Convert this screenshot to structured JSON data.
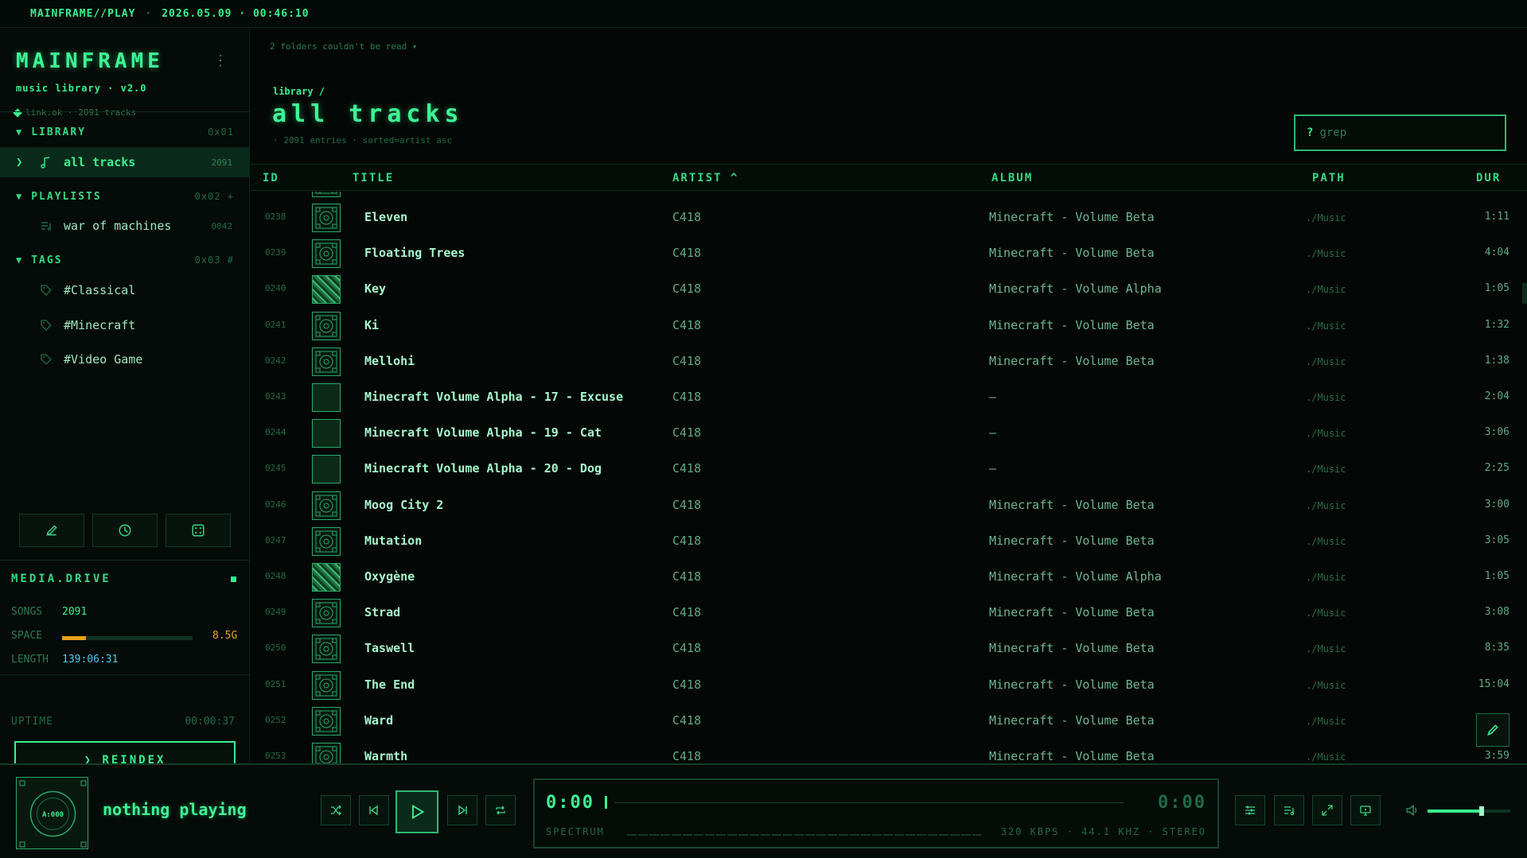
{
  "topbar": {
    "brand": "MAINFRAME//PLAY",
    "separator": "·",
    "datetime": "2026.05.09 · 00:46:10"
  },
  "sidebar": {
    "logo": "MAINFRAME",
    "subtitle": "music library · v2.0",
    "status": "link.ok · 2091 tracks",
    "library": {
      "title": "LIBRARY",
      "hex": "0x01",
      "items": [
        {
          "label": "all tracks",
          "count": "2091",
          "icon": "music-note-icon"
        }
      ]
    },
    "playlists": {
      "title": "PLAYLISTS",
      "hex": "0x02 +",
      "items": [
        {
          "label": "war of machines",
          "count": "0042",
          "icon": "playlist-icon"
        }
      ]
    },
    "tags": {
      "title": "TAGS",
      "hex": "0x03 #",
      "items": [
        {
          "label": "#Classical",
          "icon": "tag-icon"
        },
        {
          "label": "#Minecraft",
          "icon": "tag-icon"
        },
        {
          "label": "#Video Game",
          "icon": "tag-icon"
        }
      ]
    },
    "tools": [
      "pencil-icon",
      "clock-icon",
      "dice-icon"
    ],
    "drive": {
      "title": "MEDIA.DRIVE",
      "songs_label": "SONGS",
      "songs": "2091",
      "space_label": "SPACE",
      "space": "8.5G",
      "space_fraction": 0.18,
      "length_label": "LENGTH",
      "length": "139:06:31",
      "uptime_label": "UPTIME",
      "uptime": "00:00:37",
      "reindex_label": "❯ REINDEX"
    }
  },
  "main": {
    "warning": "2 folders couldn't be read ▾",
    "breadcrumb": "library /",
    "title": "all tracks",
    "entries": "· 2091 entries · sorted=artist asc",
    "search_placeholder": "grep",
    "search_prompt": "?",
    "columns": {
      "id": "ID",
      "title": "TITLE",
      "artist": "ARTIST ^",
      "album": "ALBUM",
      "path": "PATH",
      "dur": "DUR"
    },
    "tracks": [
      {
        "id": "0238",
        "title": "Eleven",
        "artist": "C418",
        "album": "Minecraft - Volume Beta",
        "path": "./Music",
        "dur": "1:11",
        "art": "beta"
      },
      {
        "id": "0239",
        "title": "Floating Trees",
        "artist": "C418",
        "album": "Minecraft - Volume Beta",
        "path": "./Music",
        "dur": "4:04",
        "art": "beta"
      },
      {
        "id": "0240",
        "title": "Key",
        "artist": "C418",
        "album": "Minecraft - Volume Alpha",
        "path": "./Music",
        "dur": "1:05",
        "art": "alpha"
      },
      {
        "id": "0241",
        "title": "Ki",
        "artist": "C418",
        "album": "Minecraft - Volume Beta",
        "path": "./Music",
        "dur": "1:32",
        "art": "beta"
      },
      {
        "id": "0242",
        "title": "Mellohi",
        "artist": "C418",
        "album": "Minecraft - Volume Beta",
        "path": "./Music",
        "dur": "1:38",
        "art": "beta"
      },
      {
        "id": "0243",
        "title": "Minecraft Volume Alpha - 17 - Excuse",
        "artist": "C418",
        "album": "–",
        "path": "./Music",
        "dur": "2:04",
        "art": "text"
      },
      {
        "id": "0244",
        "title": "Minecraft Volume Alpha - 19 - Cat",
        "artist": "C418",
        "album": "–",
        "path": "./Music",
        "dur": "3:06",
        "art": "text"
      },
      {
        "id": "0245",
        "title": "Minecraft Volume Alpha - 20 - Dog",
        "artist": "C418",
        "album": "–",
        "path": "./Music",
        "dur": "2:25",
        "art": "text"
      },
      {
        "id": "0246",
        "title": "Moog City 2",
        "artist": "C418",
        "album": "Minecraft - Volume Beta",
        "path": "./Music",
        "dur": "3:00",
        "art": "beta"
      },
      {
        "id": "0247",
        "title": "Mutation",
        "artist": "C418",
        "album": "Minecraft - Volume Beta",
        "path": "./Music",
        "dur": "3:05",
        "art": "beta"
      },
      {
        "id": "0248",
        "title": "Oxygène",
        "artist": "C418",
        "album": "Minecraft - Volume Alpha",
        "path": "./Music",
        "dur": "1:05",
        "art": "alpha"
      },
      {
        "id": "0249",
        "title": "Strad",
        "artist": "C418",
        "album": "Minecraft - Volume Beta",
        "path": "./Music",
        "dur": "3:08",
        "art": "beta"
      },
      {
        "id": "0250",
        "title": "Taswell",
        "artist": "C418",
        "album": "Minecraft - Volume Beta",
        "path": "./Music",
        "dur": "8:35",
        "art": "beta"
      },
      {
        "id": "0251",
        "title": "The End",
        "artist": "C418",
        "album": "Minecraft - Volume Beta",
        "path": "./Music",
        "dur": "15:04",
        "art": "beta"
      },
      {
        "id": "0252",
        "title": "Ward",
        "artist": "C418",
        "album": "Minecraft - Volume Beta",
        "path": "./Music",
        "dur": "",
        "art": "beta"
      },
      {
        "id": "0253",
        "title": "Warmth",
        "artist": "C418",
        "album": "Minecraft - Volume Beta",
        "path": "./Music",
        "dur": "3:59",
        "art": "beta"
      }
    ]
  },
  "player": {
    "cover_label": "A:000",
    "now_playing": "nothing playing",
    "current_time": "0:00",
    "total_time": "0:00",
    "spectrum_label": "SPECTRUM",
    "format": "320 KBPS · 44.1 KHZ · STEREO",
    "volume_fraction": 0.65
  }
}
